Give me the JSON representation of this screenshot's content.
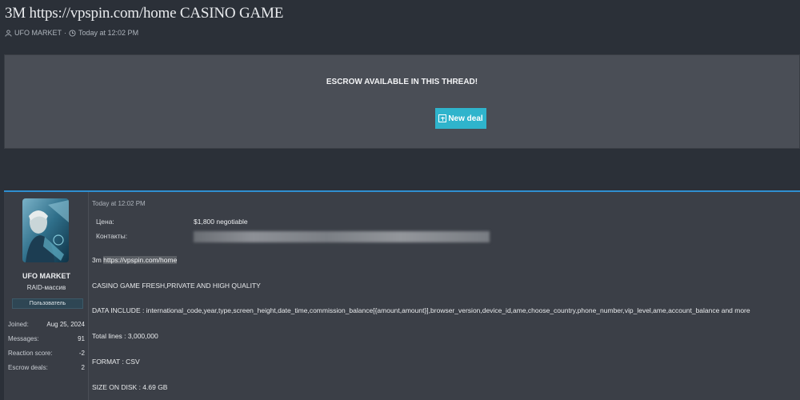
{
  "thread": {
    "title": "3M https://vpspin.com/home CASINO GAME",
    "author": "UFO MARKET",
    "separator": "·",
    "time": "Today at 12:02 PM"
  },
  "escrow": {
    "notice": "ESCROW AVAILABLE IN THIS THREAD!",
    "button_label": "New deal",
    "button_color": "#2fb4cc"
  },
  "post": {
    "date": "Today at 12:02 PM",
    "user": {
      "name": "UFO MARKET",
      "title": "RAID-массив",
      "badge": "Пользователь",
      "stats": [
        {
          "label": "Joined:",
          "value": "Aug 25, 2024"
        },
        {
          "label": "Messages:",
          "value": "91"
        },
        {
          "label": "Reaction score:",
          "value": "-2"
        },
        {
          "label": "Escrow deals:",
          "value": "2"
        }
      ]
    },
    "fields": [
      {
        "label": "Цена:",
        "value": "$1,800 negotiable"
      },
      {
        "label": "Контакты:",
        "value": ""
      }
    ],
    "intro_prefix": "3m ",
    "intro_link": "https://vpspin.com/home",
    "lines": [
      "CASINO GAME FRESH,PRIVATE AND HIGH QUALITY",
      "DATA INCLUDE : international_code,year,type,screen_height,date_time,commission_balance[{amount,amount}],browser_version,device_id,ame,choose_country,phone_number,vip_level,ame,account_balance and more",
      "Total lines : 3,000,000",
      "FORMAT : CSV",
      "SIZE ON DISK : 4.69 GB"
    ]
  },
  "colors": {
    "page_bg": "#2b3038",
    "panel_bg": "#4a4e56",
    "accent_border": "#2f8fd0"
  }
}
